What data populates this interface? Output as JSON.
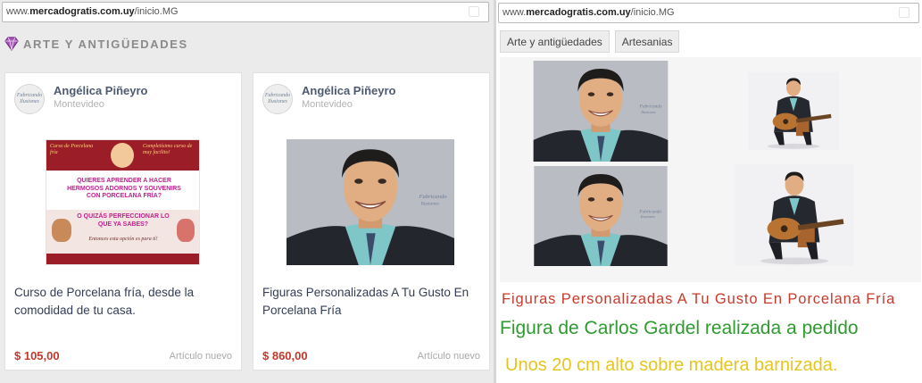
{
  "left_panel": {
    "url": {
      "prefix": "www.",
      "domain": "mercadogratis.com.uy",
      "path": "/inicio.MG"
    },
    "category": {
      "icon": "gem-icon",
      "title": "ARTE Y ANTIGÜEDADES"
    },
    "listings": [
      {
        "seller_name": "Angélica Piñeyro",
        "seller_city": "Montevideo",
        "avatar_text": "Fabricando Ilusiones",
        "flyer": {
          "banner_left": "Curso de Porcelana fría",
          "banner_right": "Completísimo curso de muy facilito!",
          "question": "QUIERES APRENDER A HACER HERMOSOS ADORNOS Y SOUVENIRS CON PORCELANA FRÍA?",
          "alternative": "O QUIZÁS PERFECCIONAR LO QUE YA SABES?",
          "closing": "Entonces esta opción es para tí!"
        },
        "title": "Curso de Porcelana fría, desde la comodidad de tu casa.",
        "price": "$ 105,00",
        "condition": "Artículo nuevo"
      },
      {
        "seller_name": "Angélica Piñeyro",
        "seller_city": "Montevideo",
        "avatar_text": "Fabricando Ilusiones",
        "title": "Figuras Personalizadas A Tu Gusto En Porcelana Fría",
        "price": "$ 860,00",
        "condition": "Artículo nuevo"
      }
    ]
  },
  "right_panel": {
    "url": {
      "prefix": "www.",
      "domain": "mercadogratis.com.uy",
      "path": "/inicio.MG"
    },
    "tabs": [
      "Arte y antigüedades",
      "Artesanias"
    ],
    "photos": [
      "figure-portrait-photo",
      "figure-guitar-full-photo",
      "figure-bust-photo",
      "figure-guitar-closeup-photo"
    ],
    "captions": {
      "line1": "Figuras Personalizadas A Tu Gusto En Porcelana Fría",
      "line2": "Figura de Carlos Gardel realizada a pedido",
      "line3": "Unos 20 cm alto sobre madera barnizada."
    },
    "colors": {
      "line1": "#c83a2b",
      "line2": "#2f9a2f",
      "line3": "#e6c51e"
    }
  },
  "colors": {
    "accent_purple": "#8e3a9d",
    "price_red": "#c0392b",
    "seller_blue": "#4e5a72"
  }
}
